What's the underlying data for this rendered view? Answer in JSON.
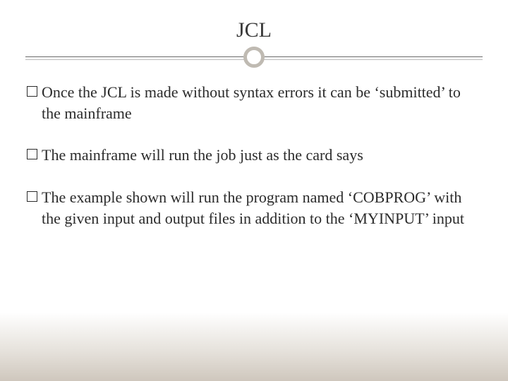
{
  "slide": {
    "title": "JCL",
    "bullets": [
      "Once the JCL is made without syntax errors it can be ‘submitted’ to the mainframe",
      "The mainframe will run the job just as the card says",
      "The example shown will run the program named ‘COBPROG’ with the given input and output files in addition to the ‘MYINPUT’ input"
    ]
  }
}
